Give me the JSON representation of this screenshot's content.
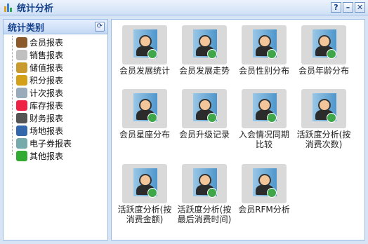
{
  "window": {
    "title": "统计分析",
    "buttons": [
      "?",
      "–",
      "✕"
    ]
  },
  "sidebar": {
    "title": "统计类别",
    "items": [
      {
        "label": "会员报表",
        "icon": "member-icon",
        "color": "#8b5a2b"
      },
      {
        "label": "销售报表",
        "icon": "sales-icon",
        "color": "#c0c0c0"
      },
      {
        "label": "储值报表",
        "icon": "money-bag-icon",
        "color": "#c99a2e"
      },
      {
        "label": "积分报表",
        "icon": "points-icon",
        "color": "#d4a017"
      },
      {
        "label": "计次报表",
        "icon": "count-icon",
        "color": "#9ab"
      },
      {
        "label": "库存报表",
        "icon": "inventory-icon",
        "color": "#e24"
      },
      {
        "label": "财务报表",
        "icon": "calculator-icon",
        "color": "#555"
      },
      {
        "label": "场地报表",
        "icon": "venue-icon",
        "color": "#36a"
      },
      {
        "label": "电子券报表",
        "icon": "coupon-icon",
        "color": "#7aa"
      },
      {
        "label": "其他报表",
        "icon": "other-icon",
        "color": "#3a3"
      }
    ]
  },
  "tiles": [
    {
      "label": "会员发展统计",
      "icon": "member-growth-icon"
    },
    {
      "label": "会员发展走势",
      "icon": "member-trend-icon"
    },
    {
      "label": "会员性别分布",
      "icon": "gender-dist-icon"
    },
    {
      "label": "会员年龄分布",
      "icon": "age-dist-icon"
    },
    {
      "label": "会员星座分布",
      "icon": "zodiac-dist-icon"
    },
    {
      "label": "会员升级记录",
      "icon": "upgrade-record-icon"
    },
    {
      "label": "入会情况同期比较",
      "icon": "join-compare-icon"
    },
    {
      "label": "活跃度分析(按消费次数)",
      "icon": "activity-count-icon"
    },
    {
      "label": "活跃度分析(按消费金额)",
      "icon": "activity-amount-icon"
    },
    {
      "label": "活跃度分析(按最后消费时间)",
      "icon": "activity-time-icon"
    },
    {
      "label": "会员RFM分析",
      "icon": "rfm-icon"
    }
  ]
}
